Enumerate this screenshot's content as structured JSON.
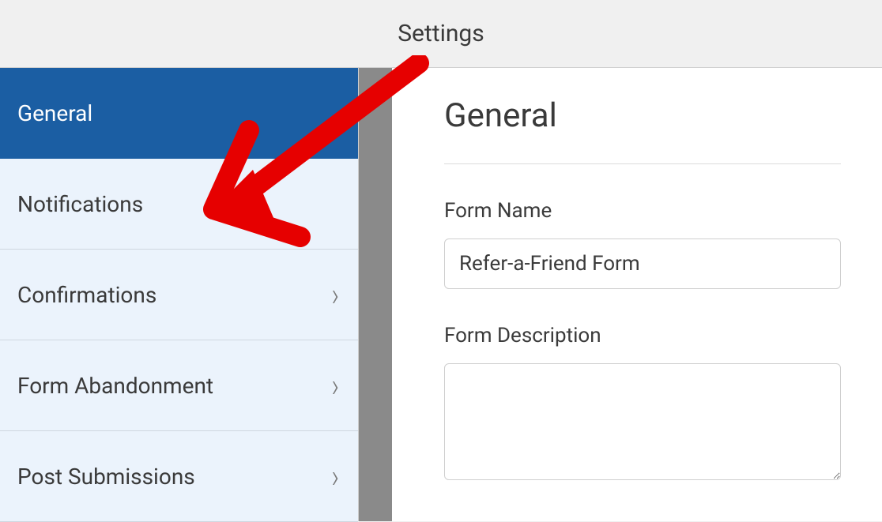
{
  "header": {
    "title": "Settings"
  },
  "sidebar": {
    "items": [
      {
        "label": "General",
        "active": true,
        "chevron": false
      },
      {
        "label": "Notifications",
        "active": false,
        "chevron": false
      },
      {
        "label": "Confirmations",
        "active": false,
        "chevron": true
      },
      {
        "label": "Form Abandonment",
        "active": false,
        "chevron": true
      },
      {
        "label": "Post Submissions",
        "active": false,
        "chevron": true
      }
    ]
  },
  "main": {
    "heading": "General",
    "fields": {
      "form_name": {
        "label": "Form Name",
        "value": "Refer-a-Friend Form"
      },
      "form_description": {
        "label": "Form Description",
        "value": ""
      }
    }
  },
  "annotation": {
    "color": "#e60000"
  }
}
